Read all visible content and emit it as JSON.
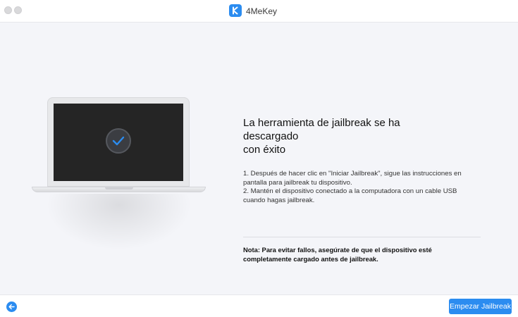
{
  "window": {
    "app_title": "4MeKey",
    "logo_letter": "K"
  },
  "content": {
    "heading_line1": "La herramienta de jailbreak se ha descargado",
    "heading_line2": "con éxito",
    "step1_line1": "1. Después de hacer clic en \"Iniciar Jailbreak\", sigue las instrucciones en",
    "step1_line2": "pantalla para jailbreak tu dispositivo.",
    "step2_line1": "2. Mantén el dispositivo conectado a la computadora con un cable USB",
    "step2_line2": "cuando hagas jailbreak.",
    "note_line1": "Nota: Para evitar fallos, asegúrate de que el dispositivo esté",
    "note_line2": "completamente cargado antes de jailbreak."
  },
  "illustration": {
    "icon": "checkmark-icon"
  },
  "footer": {
    "back_icon": "arrow-left-icon",
    "primary_button_label": "Empezar Jailbreak"
  },
  "colors": {
    "accent": "#2b8cf0",
    "background": "#f4f5f9",
    "screen": "#252525"
  }
}
